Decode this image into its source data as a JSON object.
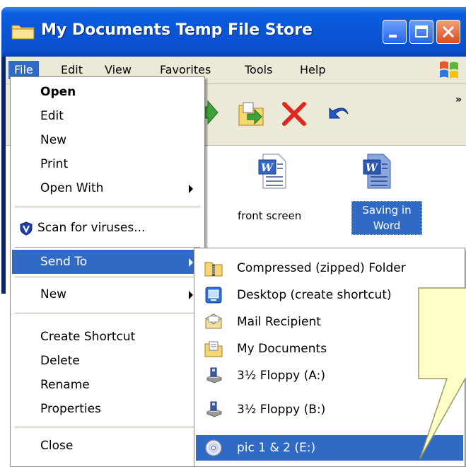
{
  "window": {
    "title": "My Documents Temp File Store"
  },
  "menubar": {
    "items": [
      "File",
      "Edit",
      "View",
      "Favorites",
      "Tools",
      "Help"
    ]
  },
  "toolbar": {
    "more": "»"
  },
  "files": [
    {
      "label": "front screen",
      "selected": false
    },
    {
      "label": "Saving in Word",
      "selected": true
    }
  ],
  "file_menu": {
    "open": "Open",
    "edit": "Edit",
    "new": "New",
    "print": "Print",
    "open_with": "Open With",
    "scan": "Scan for viruses...",
    "send_to": "Send To",
    "new2": "New",
    "create_shortcut": "Create Shortcut",
    "delete": "Delete",
    "rename": "Rename",
    "properties": "Properties",
    "close": "Close"
  },
  "send_to_menu": {
    "items": [
      "Compressed (zipped) Folder",
      "Desktop (create shortcut)",
      "Mail Recipient",
      "My Documents",
      "3½ Floppy (A:)",
      "3½ Floppy (B:)",
      "pic 1 & 2 (E:)"
    ]
  },
  "colors": {
    "highlight": "#316ac5",
    "title_blue": "#0a55d6",
    "menu_bg": "#ece9d8",
    "callout_bg": "#ffffc8"
  }
}
